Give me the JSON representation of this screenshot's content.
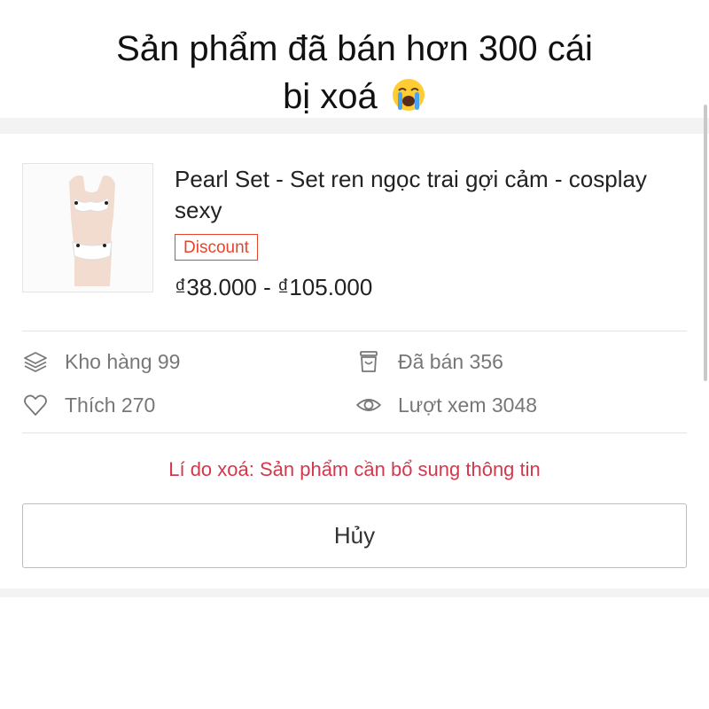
{
  "caption": {
    "line1": "Sản phẩm đã bán hơn 300 cái",
    "line2": "bị xoá",
    "emoji_icon": "loudly-crying-face-icon"
  },
  "product": {
    "name": "Pearl Set - Set ren ngọc trai gợi cảm - cosplay sexy",
    "badge": "Discount",
    "price": "₫38.000 - ₫105.000",
    "thumbnail_icon": "lingerie-on-mannequin-image"
  },
  "stats": {
    "stock": {
      "label": "Kho hàng 99",
      "icon": "stack-layers-icon"
    },
    "sold": {
      "label": "Đã bán 356",
      "icon": "shopping-bag-icon"
    },
    "likes": {
      "label": "Thích 270",
      "icon": "heart-icon"
    },
    "views": {
      "label": "Lượt xem 3048",
      "icon": "eye-icon"
    }
  },
  "deletion_reason": "Lí do xoá: Sản phẩm cần bổ sung thông tin",
  "cancel_button": "Hủy",
  "colors": {
    "badge": "#e5452c",
    "reason_text": "#d3384c",
    "muted_text": "#777777",
    "band": "#f3f3f3"
  }
}
